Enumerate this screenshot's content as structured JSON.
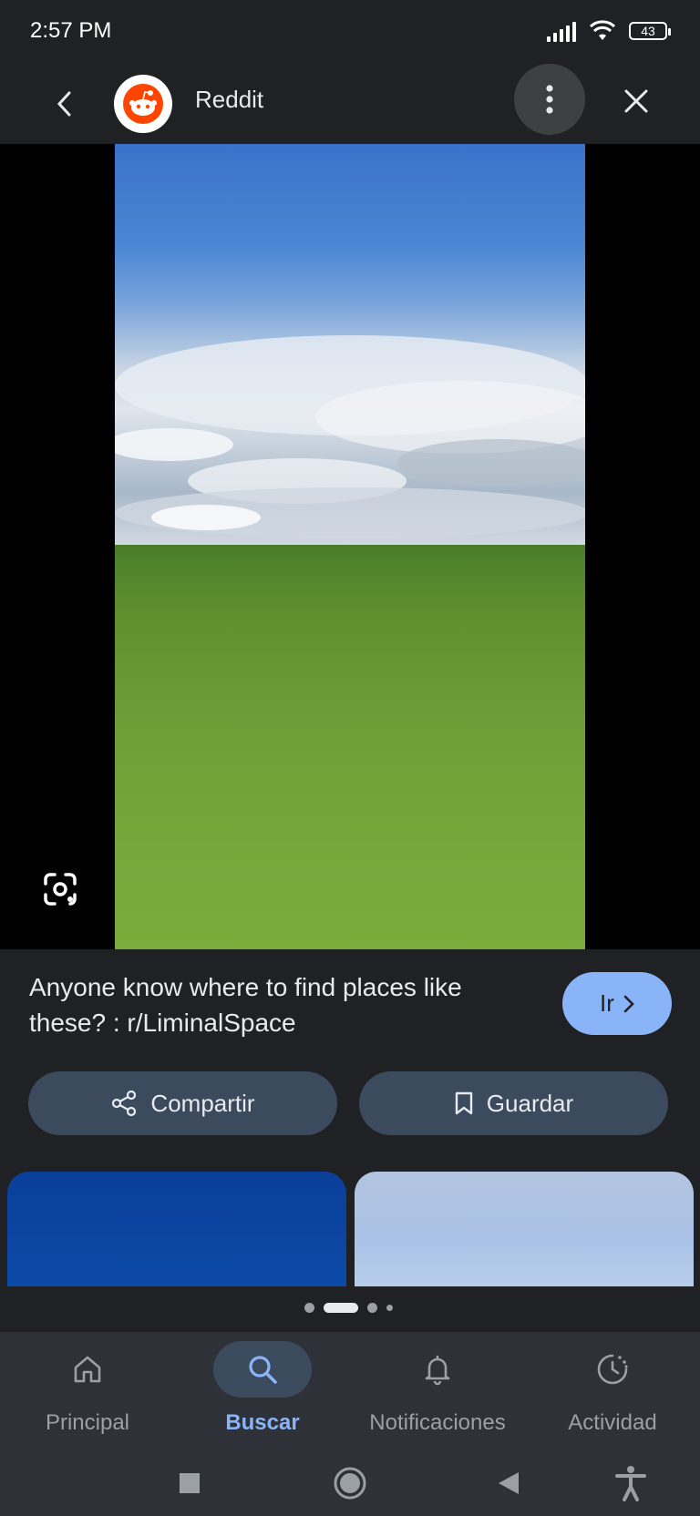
{
  "status": {
    "time": "2:57 PM",
    "battery": "43"
  },
  "header": {
    "site_name": "Reddit"
  },
  "result": {
    "title": "Anyone know where to find places like these? : r/LiminalSpace",
    "go_label": "Ir"
  },
  "actions": {
    "share_label": "Compartir",
    "save_label": "Guardar"
  },
  "nav": {
    "items": [
      {
        "label": "Principal",
        "icon": "home-icon"
      },
      {
        "label": "Buscar",
        "icon": "search-icon",
        "active": true
      },
      {
        "label": "Notificaciones",
        "icon": "bell-icon"
      },
      {
        "label": "Actividad",
        "icon": "history-icon"
      }
    ]
  },
  "colors": {
    "accent": "#8ab4f8",
    "background": "#202124",
    "button": "#3c4a5e"
  }
}
